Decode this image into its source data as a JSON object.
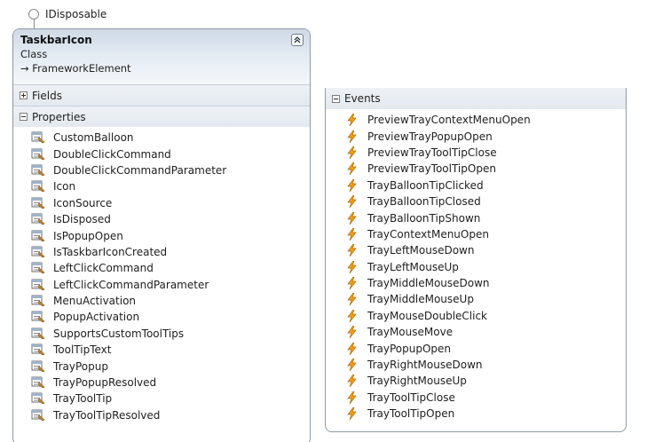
{
  "interface": {
    "name": "IDisposable"
  },
  "class": {
    "name": "TaskbarIcon",
    "kind": "Class",
    "base": "→ FrameworkElement"
  },
  "sections": {
    "fields": {
      "title": "Fields"
    },
    "properties": {
      "title": "Properties",
      "items": [
        "CustomBalloon",
        "DoubleClickCommand",
        "DoubleClickCommandParameter",
        "Icon",
        "IconSource",
        "IsDisposed",
        "IsPopupOpen",
        "IsTaskbarIconCreated",
        "LeftClickCommand",
        "LeftClickCommandParameter",
        "MenuActivation",
        "PopupActivation",
        "SupportsCustomToolTips",
        "ToolTipText",
        "TrayPopup",
        "TrayPopupResolved",
        "TrayToolTip",
        "TrayToolTipResolved"
      ]
    },
    "events": {
      "title": "Events",
      "items": [
        "PreviewTrayContextMenuOpen",
        "PreviewTrayPopupOpen",
        "PreviewTrayToolTipClose",
        "PreviewTrayToolTipOpen",
        "TrayBalloonTipClicked",
        "TrayBalloonTipClosed",
        "TrayBalloonTipShown",
        "TrayContextMenuOpen",
        "TrayLeftMouseDown",
        "TrayLeftMouseUp",
        "TrayMiddleMouseDown",
        "TrayMiddleMouseUp",
        "TrayMouseDoubleClick",
        "TrayMouseMove",
        "TrayPopupOpen",
        "TrayRightMouseDown",
        "TrayRightMouseUp",
        "TrayToolTipClose",
        "TrayToolTipOpen"
      ]
    }
  },
  "icons": {
    "property": "property-icon",
    "event": "event-lightning-icon",
    "collapse": "collapse-chevron-up-icon"
  },
  "colors": {
    "header_top": "#cfdae6",
    "border": "#8f9aa7",
    "event_bolt": "#f0a020"
  }
}
